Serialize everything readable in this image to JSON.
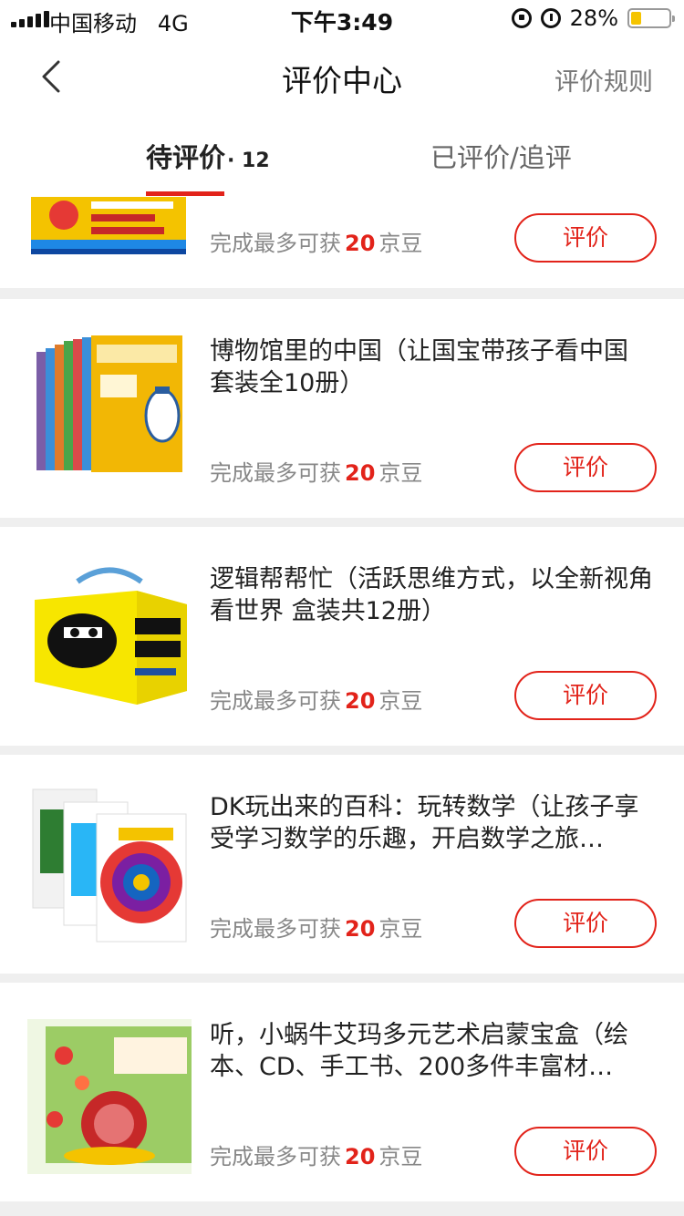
{
  "status_bar": {
    "carrier": "中国移动",
    "network": "4G",
    "time": "下午3:49",
    "battery_percent": "28%",
    "battery_level": 0.28,
    "battery_color": "#f5c400"
  },
  "nav": {
    "back_icon": "chevron-left-icon",
    "title": "评价中心",
    "right_link": "评价规则"
  },
  "tabs": {
    "pending_label": "待评价",
    "pending_count": "· 12",
    "done_label": "已评价/追评",
    "active_color": "#e2231a"
  },
  "reward_prefix": "完成最多可获",
  "reward_unit": "京豆",
  "items": [
    {
      "title": "",
      "reward_amount": "20",
      "button": "评价",
      "thumb": "super-wings-book-set"
    },
    {
      "title": "博物馆里的中国（让国宝带孩子看中国 套装全10册）",
      "reward_amount": "20",
      "button": "评价",
      "thumb": "museum-china-book-set"
    },
    {
      "title": "逻辑帮帮忙（活跃思维方式，以全新视角看世界 盒装共12册）",
      "reward_amount": "20",
      "button": "评价",
      "thumb": "logic-help-box-set"
    },
    {
      "title": "DK玩出来的百科：玩转数学（让孩子享受学习数学的乐趣，开启数学之旅…",
      "reward_amount": "20",
      "button": "评价",
      "thumb": "dk-math-book-set"
    },
    {
      "title": "听，小蜗牛艾玛多元艺术启蒙宝盒（绘本、CD、手工书、200多件丰富材…",
      "reward_amount": "20",
      "button": "评价",
      "thumb": "snail-emma-art-box"
    }
  ],
  "accent_color": "#e2231a"
}
